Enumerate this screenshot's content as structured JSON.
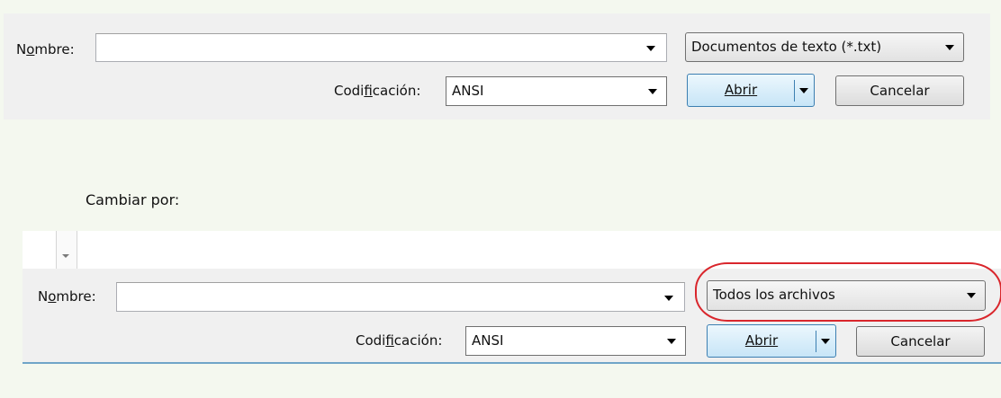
{
  "dialog_top": {
    "name_label": "Nombre:",
    "name_value": "",
    "filetype_selected": "Documentos de texto (*.txt)",
    "encoding_label": "Codificación:",
    "encoding_selected": "ANSI",
    "open_label": "Abrir",
    "cancel_label": "Cancelar"
  },
  "caption": "Cambiar por:",
  "dialog_bottom": {
    "name_label": "Nombre:",
    "name_value": "",
    "filetype_selected": "Todos los archivos",
    "encoding_label": "Codificación:",
    "encoding_selected": "ANSI",
    "open_label": "Abrir",
    "cancel_label": "Cancelar"
  },
  "colors": {
    "highlight_ellipse": "#d9262c",
    "primary_button_border": "#3c7fb1",
    "page_background": "#f4f8ef"
  }
}
